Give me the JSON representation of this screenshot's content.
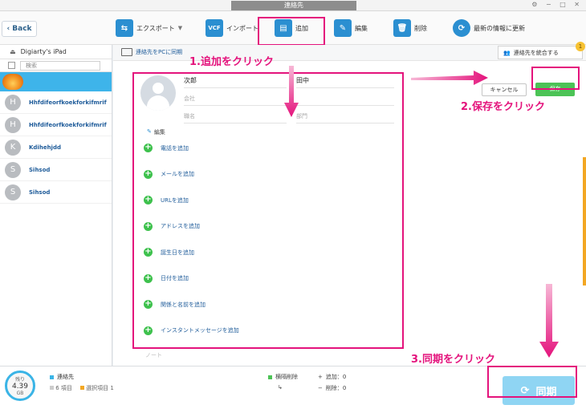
{
  "window": {
    "title": "連絡先",
    "controls": "⚙ − □ ✕"
  },
  "toolbar": {
    "back_label": "Back",
    "export_label": "エクスポート",
    "import_label": "インポート",
    "add_label": "追加",
    "edit_label": "編集",
    "delete_label": "削除",
    "refresh_label": "最新の情報に更新"
  },
  "sidebar": {
    "device_name": "Digiarty's iPad",
    "search_placeholder": "検索",
    "contacts": [
      {
        "initial": "H",
        "name": "Hhfdifeorfkoekforkifmrif"
      },
      {
        "initial": "H",
        "name": "Hhfdifeorfkoekforkifmrif"
      },
      {
        "initial": "K",
        "name": "Kdihehjdd"
      },
      {
        "initial": "S",
        "name": "Sihsod"
      },
      {
        "initial": "S",
        "name": "Sihsod"
      }
    ]
  },
  "main": {
    "sync_pc_label": "連絡先をPCに同期",
    "merge_label": "連絡先を統合する",
    "merge_badge": "1",
    "cancel_label": "キャンセル",
    "save_label": "保存",
    "form": {
      "first_name": "次郎",
      "last_name": "田中",
      "company_placeholder": "会社",
      "job_placeholder": "職名",
      "dept_placeholder": "部門",
      "edit_label": "編集",
      "add_items": [
        "電話を追加",
        "メールを追加",
        "URLを追加",
        "アドレスを追加",
        "誕生日を追加",
        "日付を追加",
        "関係と名前を追加",
        "インスタントメッセージを追加"
      ],
      "note_label": "ノート"
    }
  },
  "bottom": {
    "storage_label": "残り",
    "storage_value": "4.39",
    "storage_unit": "GB",
    "category": "連絡先",
    "items_count": "6 項目",
    "selected_count": "選択項目 1",
    "pending_delete": "横隔削除",
    "add_count": "追加：0",
    "delete_count": "削除：0",
    "sync_label": "同期"
  },
  "annotations": {
    "step1": "1.追加をクリック",
    "step2": "2.保存をクリック",
    "step3": "3.同期をクリック"
  },
  "colors": {
    "accent": "#e4137c",
    "primary": "#2b8fd1",
    "save": "#4cc356",
    "selected": "#3eb4ea"
  }
}
